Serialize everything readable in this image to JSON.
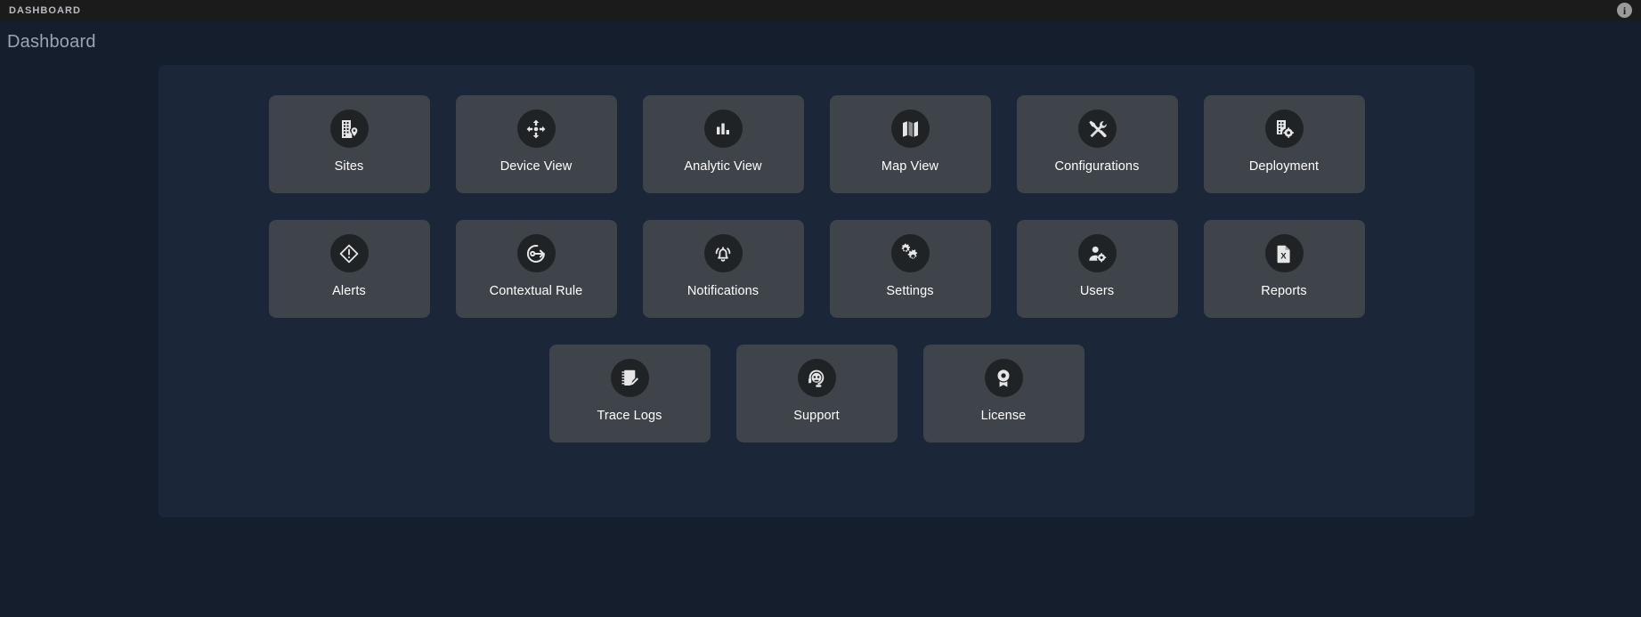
{
  "topbar": {
    "title": "DASHBOARD",
    "info_icon": "info-icon",
    "info_glyph": "i"
  },
  "page": {
    "title": "Dashboard",
    "background_color": "#151e2d",
    "panel_color": "#1b2639",
    "tile_color": "#3e4449",
    "tile_icon_bg": "#1f2326",
    "label_color": "#ffffff"
  },
  "tiles": {
    "row1": [
      {
        "label": "Sites",
        "icon": "building-location-icon"
      },
      {
        "label": "Device View",
        "icon": "move-arrows-icon"
      },
      {
        "label": "Analytic View",
        "icon": "bar-chart-icon"
      },
      {
        "label": "Map View",
        "icon": "map-icon"
      },
      {
        "label": "Configurations",
        "icon": "tools-hammer-wrench-icon"
      },
      {
        "label": "Deployment",
        "icon": "building-gear-icon"
      }
    ],
    "row2": [
      {
        "label": "Alerts",
        "icon": "diamond-exclamation-icon"
      },
      {
        "label": "Contextual Rule",
        "icon": "circle-arrow-right-icon"
      },
      {
        "label": "Notifications",
        "icon": "bell-ringing-icon"
      },
      {
        "label": "Settings",
        "icon": "gears-icon"
      },
      {
        "label": "Users",
        "icon": "person-gear-icon"
      },
      {
        "label": "Reports",
        "icon": "file-excel-icon"
      }
    ],
    "row3": [
      {
        "label": "Trace Logs",
        "icon": "notebook-pencil-icon"
      },
      {
        "label": "Support",
        "icon": "headset-agent-icon"
      },
      {
        "label": "License",
        "icon": "award-badge-icon"
      }
    ]
  }
}
